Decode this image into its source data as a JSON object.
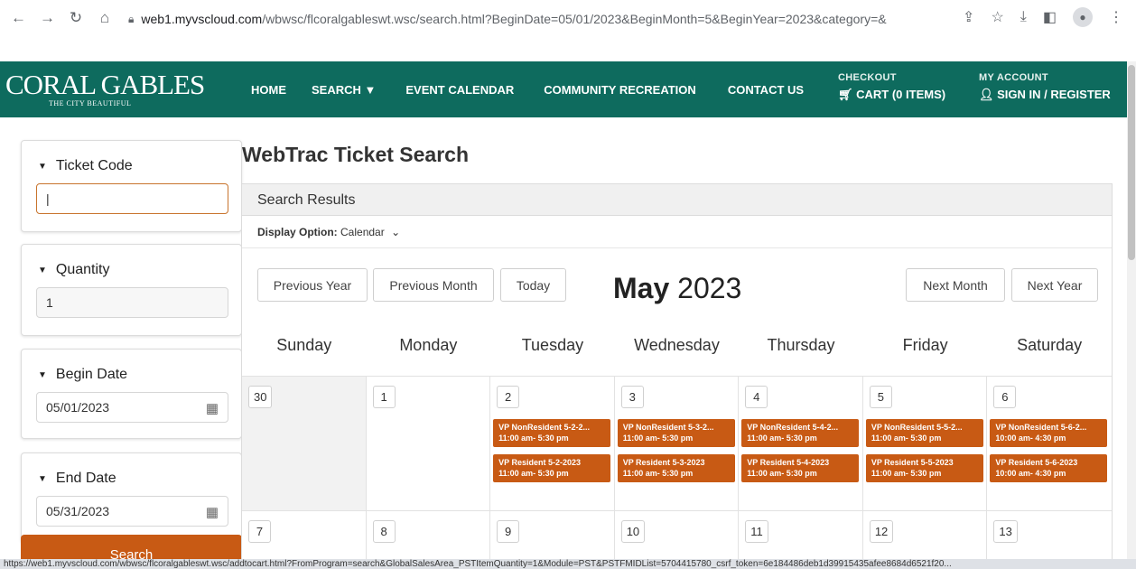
{
  "browser": {
    "url_host": "web1.myvscloud.com",
    "url_path": "/wbwsc/flcoralgableswt.wsc/search.html?BeginDate=05/01/2023&BeginMonth=5&BeginYear=2023&category=&Date=05...",
    "status_url": "https://web1.myvscloud.com/wbwsc/flcoralgableswt.wsc/addtocart.html?FromProgram=search&GlobalSalesArea_PSTItemQuantity=1&Module=PST&PSTFMIDList=5704415780_csrf_token=6e184486deb1d39915435afee8684d6521f20..."
  },
  "site": {
    "logo_text": "CORAL GABLES",
    "logo_sub": "THE CITY BEAUTIFUL",
    "nav": [
      {
        "label": "HOME"
      },
      {
        "label": "SEARCH ▼"
      },
      {
        "label": "EVENT CALENDAR"
      },
      {
        "label": "COMMUNITY RECREATION"
      },
      {
        "label": "CONTACT US"
      }
    ],
    "checkout_label": "CHECKOUT",
    "cart_label": "CART (0 ITEMS)",
    "account_label": "MY ACCOUNT",
    "signin_label": "SIGN IN / REGISTER",
    "accent": "#0e6b5e",
    "event_color": "#c85a14"
  },
  "sidebar": {
    "ticket_code": {
      "title": "Ticket Code",
      "value": "|"
    },
    "quantity": {
      "title": "Quantity",
      "value": "1"
    },
    "begin_date": {
      "title": "Begin Date",
      "value": "05/01/2023"
    },
    "end_date": {
      "title": "End Date",
      "value": "05/31/2023"
    },
    "search_label": "Search"
  },
  "main": {
    "title": "WebTrac Ticket Search",
    "results_header": "Search Results",
    "display_option_label": "Display Option:",
    "display_option_value": "Calendar",
    "buttons": {
      "prev_year": "Previous Year",
      "prev_month": "Previous Month",
      "today": "Today",
      "next_month": "Next Month",
      "next_year": "Next Year"
    },
    "month_name": "May",
    "year": "2023",
    "days_of_week": [
      "Sunday",
      "Monday",
      "Tuesday",
      "Wednesday",
      "Thursday",
      "Friday",
      "Saturday"
    ],
    "weeks": [
      {
        "days": [
          {
            "num": "30",
            "outside": true,
            "events": []
          },
          {
            "num": "1",
            "events": []
          },
          {
            "num": "2",
            "events": [
              {
                "name": "VP NonResident 5-2-2...",
                "time": "11:00 am- 5:30 pm"
              },
              {
                "name": "VP Resident 5-2-2023",
                "time": "11:00 am- 5:30 pm"
              }
            ]
          },
          {
            "num": "3",
            "events": [
              {
                "name": "VP NonResident 5-3-2...",
                "time": "11:00 am- 5:30 pm"
              },
              {
                "name": "VP Resident 5-3-2023",
                "time": "11:00 am- 5:30 pm"
              }
            ]
          },
          {
            "num": "4",
            "events": [
              {
                "name": "VP NonResident 5-4-2...",
                "time": "11:00 am- 5:30 pm"
              },
              {
                "name": "VP Resident 5-4-2023",
                "time": "11:00 am- 5:30 pm"
              }
            ]
          },
          {
            "num": "5",
            "events": [
              {
                "name": "VP NonResident 5-5-2...",
                "time": "11:00 am- 5:30 pm"
              },
              {
                "name": "VP Resident 5-5-2023",
                "time": "11:00 am- 5:30 pm"
              }
            ]
          },
          {
            "num": "6",
            "events": [
              {
                "name": "VP NonResident 5-6-2...",
                "time": "10:00 am- 4:30 pm"
              },
              {
                "name": "VP Resident 5-6-2023",
                "time": "10:00 am- 4:30 pm"
              }
            ]
          }
        ]
      },
      {
        "days": [
          {
            "num": "7",
            "events": []
          },
          {
            "num": "8",
            "events": []
          },
          {
            "num": "9",
            "events": []
          },
          {
            "num": "10",
            "events": []
          },
          {
            "num": "11",
            "events": []
          },
          {
            "num": "12",
            "events": []
          },
          {
            "num": "13",
            "events": []
          }
        ]
      }
    ]
  }
}
